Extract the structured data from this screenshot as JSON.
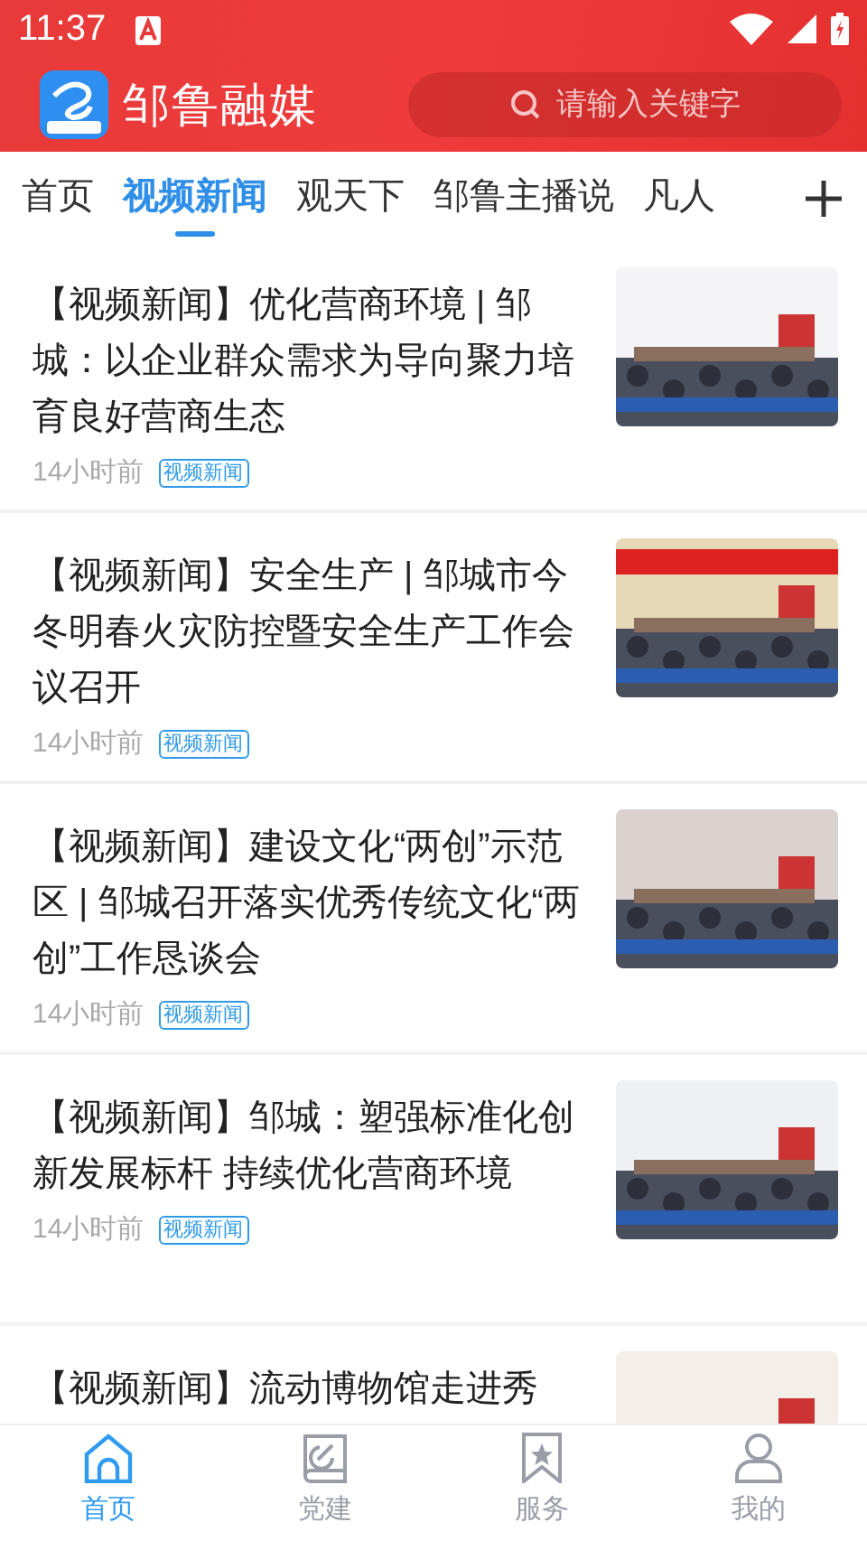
{
  "status_bar": {
    "time": "11:37"
  },
  "header": {
    "app_name": "邹鲁融媒",
    "search": {
      "placeholder": "请输入关键字"
    }
  },
  "tabs": [
    {
      "label": "首页",
      "selected": false
    },
    {
      "label": "视频新闻",
      "selected": true
    },
    {
      "label": "观天下",
      "selected": false
    },
    {
      "label": "邹鲁主播说",
      "selected": false
    },
    {
      "label": "凡人",
      "selected": false
    }
  ],
  "articles": [
    {
      "title": "【视频新闻】优化营商环境 | 邹城：以企业群众需求为导向聚力培育良好营商生态",
      "time": "14小时前",
      "tag": "视频新闻"
    },
    {
      "title": "【视频新闻】安全生产 | 邹城市今冬明春火灾防控暨安全生产工作会议召开",
      "time": "14小时前",
      "tag": "视频新闻"
    },
    {
      "title": "【视频新闻】建设文化“两创”示范区 | 邹城召开落实优秀传统文化“两创”工作恳谈会",
      "time": "14小时前",
      "tag": "视频新闻"
    },
    {
      "title": "【视频新闻】邹城：塑强标准化创新发展标杆 持续优化营商环境",
      "time": "14小时前",
      "tag": "视频新闻"
    },
    {
      "title": "【视频新闻】流动博物馆走进秀"
    }
  ],
  "bottom_nav": [
    {
      "label": "首页",
      "kind": "home",
      "selected": true
    },
    {
      "label": "党建",
      "kind": "book",
      "selected": false
    },
    {
      "label": "服务",
      "kind": "bookmark",
      "selected": false
    },
    {
      "label": "我的",
      "kind": "person",
      "selected": false
    }
  ]
}
